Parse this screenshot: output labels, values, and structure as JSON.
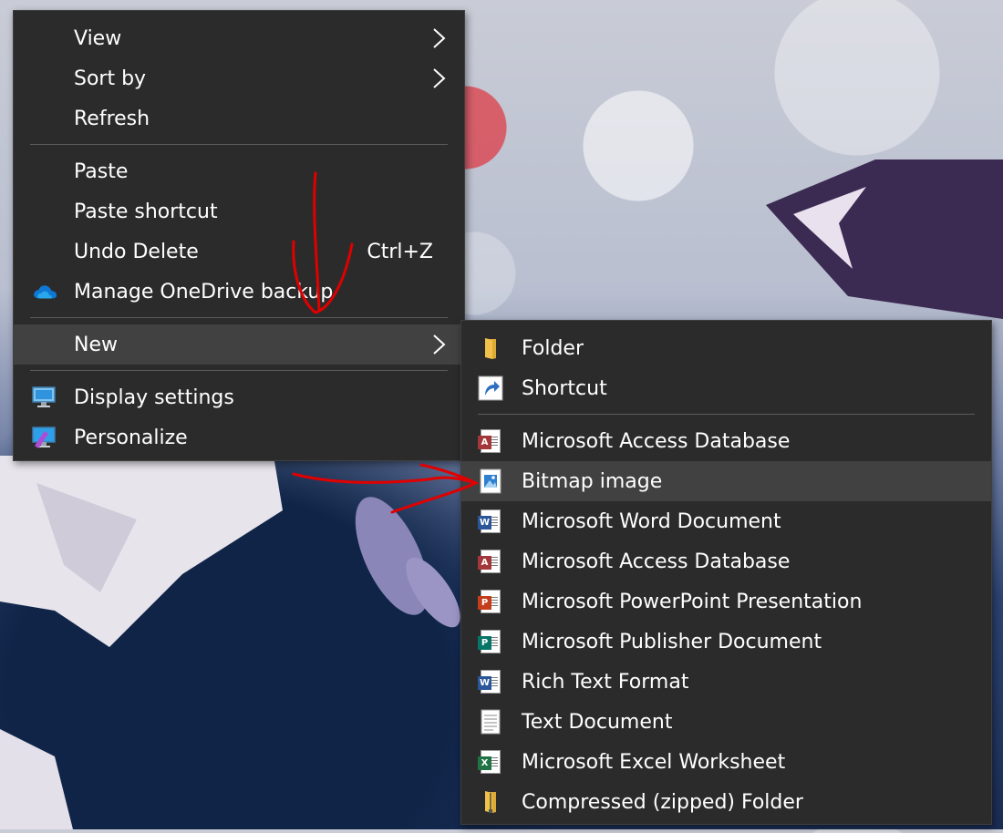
{
  "context_menu": {
    "items": [
      {
        "label": "View",
        "has_submenu": true
      },
      {
        "label": "Sort by",
        "has_submenu": true
      },
      {
        "label": "Refresh"
      },
      {
        "label": "Paste"
      },
      {
        "label": "Paste shortcut"
      },
      {
        "label": "Undo Delete",
        "shortcut": "Ctrl+Z"
      },
      {
        "label": "Manage OneDrive backup",
        "icon": "onedrive-cloud-icon"
      },
      {
        "label": "New",
        "has_submenu": true,
        "highlighted": true
      },
      {
        "label": "Display settings",
        "icon": "display-settings-icon"
      },
      {
        "label": "Personalize",
        "icon": "personalize-icon"
      }
    ]
  },
  "new_submenu": {
    "items": [
      {
        "label": "Folder",
        "icon": "folder-icon"
      },
      {
        "label": "Shortcut",
        "icon": "shortcut-icon"
      },
      {
        "label": "Microsoft Access Database",
        "icon": "access-icon",
        "color": "#a4373a",
        "badge": "A"
      },
      {
        "label": "Bitmap image",
        "icon": "bitmap-icon",
        "highlighted": true
      },
      {
        "label": "Microsoft Word Document",
        "icon": "word-icon",
        "color": "#2b579a",
        "badge": "W"
      },
      {
        "label": "Microsoft Access Database",
        "icon": "access-icon",
        "color": "#a4373a",
        "badge": "A"
      },
      {
        "label": "Microsoft PowerPoint Presentation",
        "icon": "powerpoint-icon",
        "color": "#c43e1c",
        "badge": "P"
      },
      {
        "label": "Microsoft Publisher Document",
        "icon": "publisher-icon",
        "color": "#077568",
        "badge": "P"
      },
      {
        "label": "Rich Text Format",
        "icon": "rtf-icon",
        "color": "#2b579a",
        "badge": "W"
      },
      {
        "label": "Text Document",
        "icon": "text-document-icon"
      },
      {
        "label": "Microsoft Excel Worksheet",
        "icon": "excel-icon",
        "color": "#217346",
        "badge": "X"
      },
      {
        "label": "Compressed (zipped) Folder",
        "icon": "zip-folder-icon"
      }
    ]
  },
  "colors": {
    "menu_bg": "#2b2b2b",
    "highlight": "#414141",
    "separator": "#5a5a5a",
    "annotation": "#e00000"
  }
}
